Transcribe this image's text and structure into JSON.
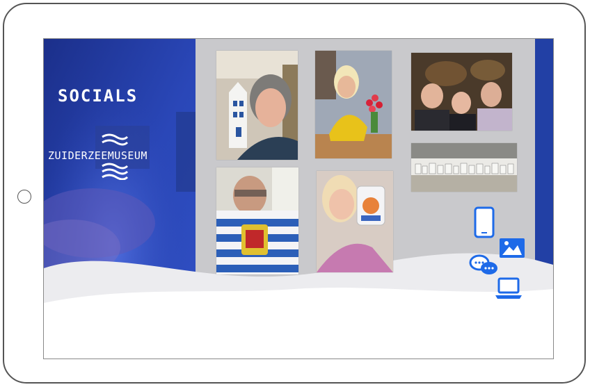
{
  "panel": {
    "title": "SOCIALS",
    "logo_text": "ZUIDERZEEMUSEUM"
  },
  "photos": [
    {
      "name": "photo-woman-with-house-model"
    },
    {
      "name": "photo-woman-with-tulips"
    },
    {
      "name": "photo-selfie-painting"
    },
    {
      "name": "photo-miniature-houses-shelf"
    },
    {
      "name": "photo-man-with-flag"
    },
    {
      "name": "photo-woman-with-product"
    }
  ],
  "icons": [
    "smartphone-icon",
    "image-icon",
    "chat-icon",
    "laptop-icon"
  ],
  "colors": {
    "brand_blue": "#1a3fa8",
    "accent_blue": "#1e6ae8",
    "panel_gray": "#c9c9cc"
  }
}
